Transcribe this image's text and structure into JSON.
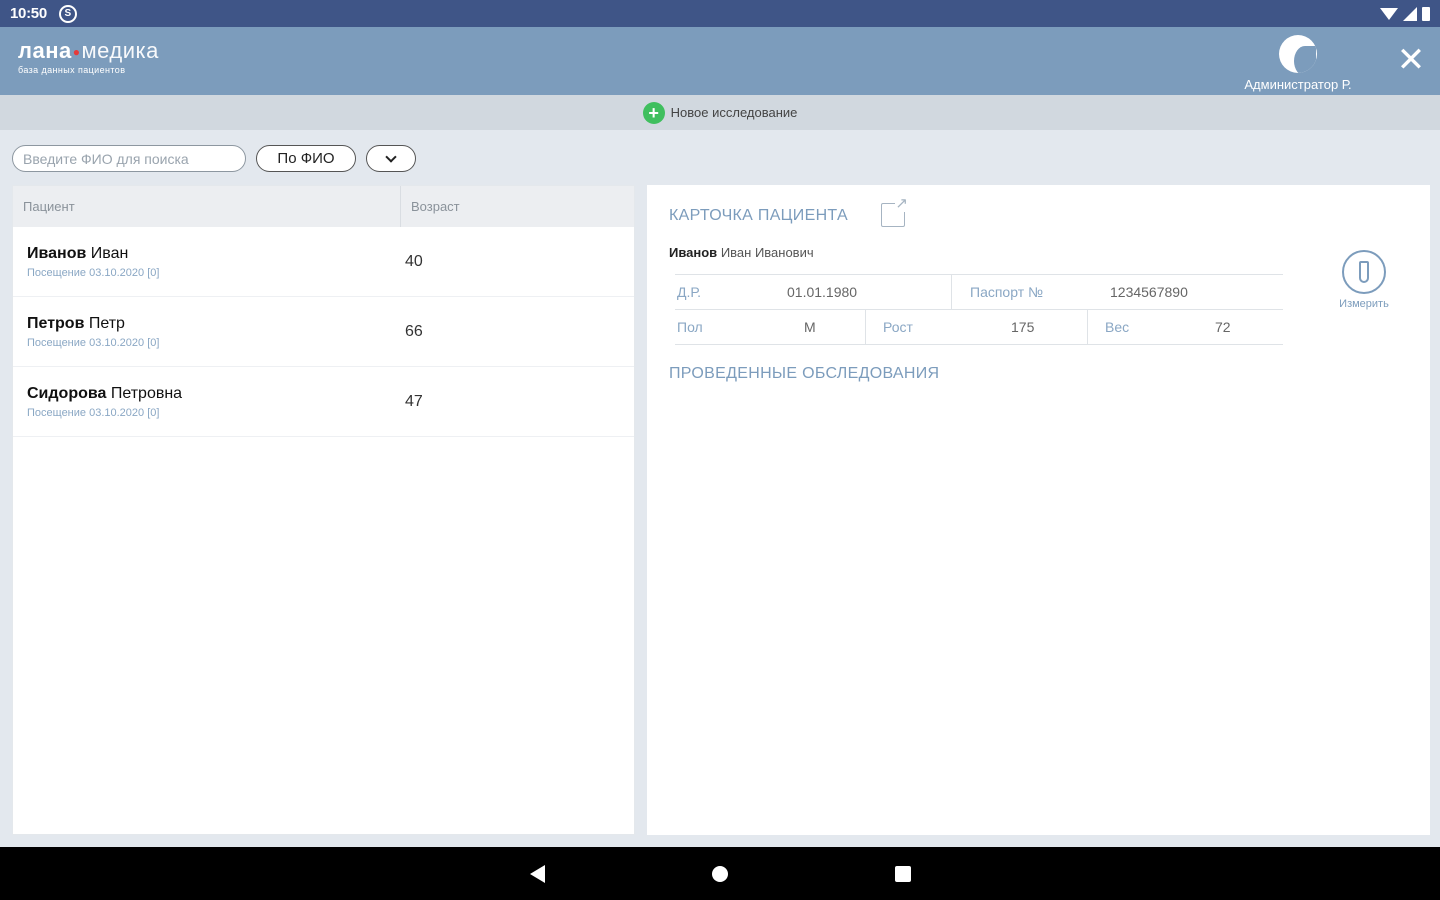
{
  "status_bar": {
    "time": "10:50",
    "sync_glyph": "S"
  },
  "header": {
    "logo_bold": "лана",
    "logo_light": "медика",
    "logo_subtitle": "база данных пациентов",
    "user_name": "Администратор Р.",
    "close_glyph": "✕"
  },
  "toolbar": {
    "new_study_label": "Новое исследование",
    "plus_glyph": "+"
  },
  "search": {
    "placeholder": "Введите ФИО для поиска",
    "mode_label": "По ФИО"
  },
  "list": {
    "headers": {
      "patient": "Пациент",
      "age": "Возраст"
    },
    "rows": [
      {
        "last_name": "Иванов",
        "first_name": "Иван",
        "visit": "Посещение 03.10.2020 [0]",
        "age": "40"
      },
      {
        "last_name": "Петров",
        "first_name": "Петр",
        "visit": "Посещение 03.10.2020 [0]",
        "age": "66"
      },
      {
        "last_name": "Сидорова",
        "first_name": "Петровна",
        "visit": "Посещение 03.10.2020 [0]",
        "age": "47"
      }
    ]
  },
  "card": {
    "title": "КАРТОЧКА ПАЦИЕНТА",
    "last_name": "Иванов",
    "rest_name": "Иван Иванович",
    "dob_label": "Д.Р.",
    "dob_value": "01.01.1980",
    "passport_label": "Паспорт №",
    "passport_value": "1234567890",
    "sex_label": "Пол",
    "sex_value": "М",
    "height_label": "Рост",
    "height_value": "175",
    "weight_label": "Вес",
    "weight_value": "72",
    "measure_label": "Измерить",
    "studies_title": "ПРОВЕДЕННЫЕ ОБСЛЕДОВАНИЯ"
  }
}
